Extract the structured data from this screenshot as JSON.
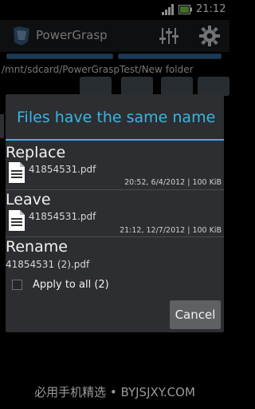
{
  "status_bar": {
    "time": "21:12"
  },
  "app": {
    "title": "PowerGrasp"
  },
  "progress": {
    "left_fraction": 1.0,
    "right_fraction": 1.0
  },
  "path": "/mnt/sdcard/PowerGraspTest/New folder",
  "dialog": {
    "title": "Files have the same name",
    "options": [
      {
        "label": "Replace",
        "filename": "41854531.pdf",
        "meta": "20:52, 6/4/2012 | 100 KiB"
      },
      {
        "label": "Leave",
        "filename": "41854531.pdf",
        "meta": "21:12, 12/7/2012 | 100 KiB"
      },
      {
        "label": "Rename",
        "filename": "41854531 (2).pdf"
      }
    ],
    "apply_to_all": {
      "label": "Apply to all (2)",
      "checked": false
    },
    "cancel_label": "Cancel"
  },
  "watermark": "必用手机精选 • BYJSJXY.COM",
  "colors": {
    "accent": "#33b5e5",
    "dialog_bg": "#2d2e31",
    "button_bg": "#5e6064"
  },
  "icons": [
    "signal-icon",
    "battery-icon",
    "app-logo-icon",
    "sliders-icon",
    "gear-icon",
    "pdf-file-icon"
  ]
}
